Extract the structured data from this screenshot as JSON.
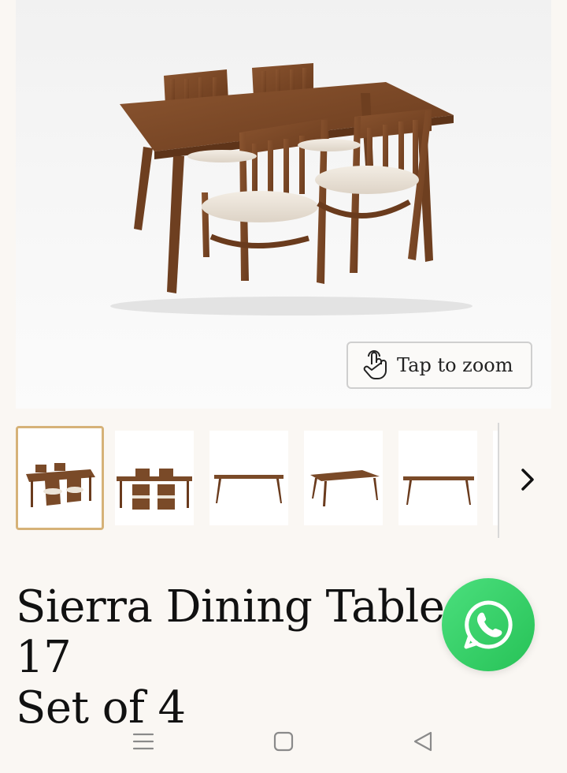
{
  "product": {
    "title_line1": "Sierra Dining Table No. 17",
    "title_line2": "Set of 4"
  },
  "zoom": {
    "label": "Tap to zoom",
    "icon": "tap-hand-icon"
  },
  "gallery": {
    "thumbnails": [
      {
        "name": "dining-set-angle-view",
        "selected": true
      },
      {
        "name": "dining-set-front-view",
        "selected": false
      },
      {
        "name": "table-front-view",
        "selected": false
      },
      {
        "name": "table-angle-view",
        "selected": false
      },
      {
        "name": "table-side-view",
        "selected": false
      }
    ],
    "next_icon": "chevron-right-icon"
  },
  "fab": {
    "icon": "whatsapp-icon",
    "color": "#25d366"
  },
  "system_nav": {
    "icons": [
      "menu-icon",
      "home-square-icon",
      "back-triangle-icon"
    ]
  },
  "colors": {
    "background": "#faf7f3",
    "wood": "#7a4a28",
    "thumb_border": "#d6b278"
  }
}
